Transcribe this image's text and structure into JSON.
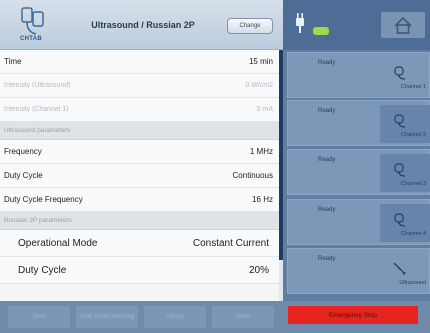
{
  "header": {
    "logo_text": "CHTAB",
    "title": "Ultrasound / Russian 2P",
    "change_label": "Change"
  },
  "settings": {
    "time": {
      "label": "Time",
      "value": "15 min"
    },
    "intensity_ultrasound": {
      "label": "Intensity (Ultrasound)",
      "value": "0 W/cm2"
    },
    "intensity_channel1": {
      "label": "Intensity (Channel 1)",
      "value": "0 mA"
    },
    "ultrasound_section": "Ultrasound parameters",
    "frequency": {
      "label": "Frequency",
      "value": "1 MHz"
    },
    "duty_cycle": {
      "label": "Duty Cycle",
      "value": "Continuous"
    },
    "duty_cycle_frequency": {
      "label": "Duty Cycle Frequency",
      "value": "16 Hz"
    },
    "russian_section": "Russian 2P parameters",
    "operational_mode": {
      "label": "Operational Mode",
      "value": "Constant Current"
    },
    "duty_cycle_2": {
      "label": "Duty Cycle",
      "value": "20%"
    }
  },
  "bottom": {
    "start": "Start",
    "start_warming": "Start Head Warming",
    "library": "Library",
    "store": "Store",
    "emergency": "Emergency Stop"
  },
  "channels": [
    {
      "status": "Ready",
      "name": "Channel 1"
    },
    {
      "status": "Ready",
      "name": "Channel 2"
    },
    {
      "status": "Ready",
      "name": "Channel 3"
    },
    {
      "status": "Ready",
      "name": "Channel 4"
    },
    {
      "status": "Ready",
      "name": "Ultrasound"
    }
  ],
  "colors": {
    "accent": "#1e3b63",
    "emergency": "#e8241e",
    "battery": "#9ed94a"
  }
}
